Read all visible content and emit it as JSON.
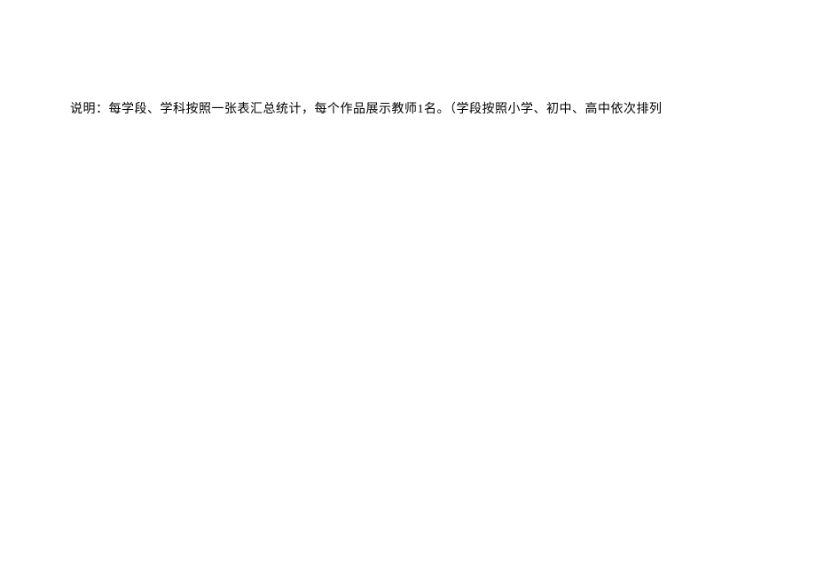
{
  "document": {
    "description_text": "说明：每学段、学科按照一张表汇总统计，每个作品展示教师1名。（学段按照小学、初中、高中依次排列"
  }
}
